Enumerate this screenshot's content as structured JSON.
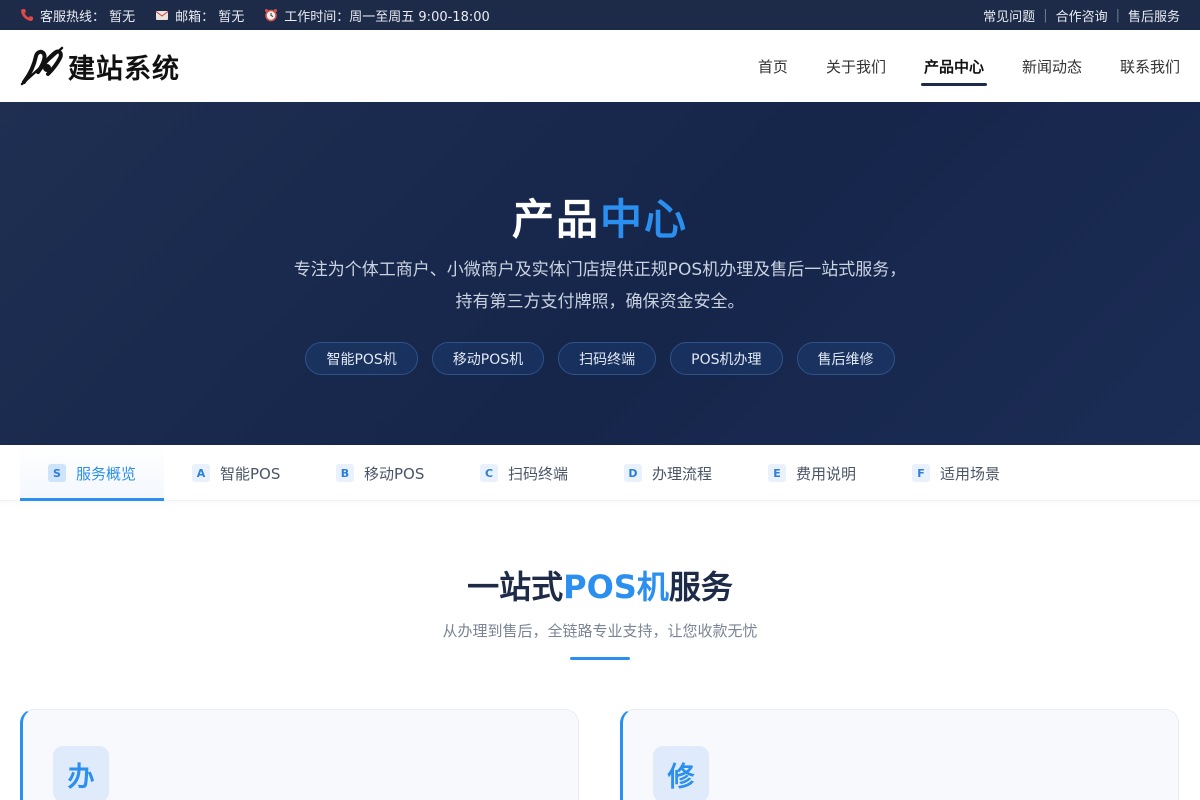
{
  "topbar": {
    "hotline": "客服热线：  暂无",
    "email": "邮箱：  暂无",
    "hours": "工作时间：周一至周五 9:00-18:00",
    "links": [
      "常见问题",
      "合作咨询",
      "售后服务"
    ]
  },
  "brand": {
    "name": "建站系统"
  },
  "nav": [
    "首页",
    "关于我们",
    "产品中心",
    "新闻动态",
    "联系我们"
  ],
  "hero": {
    "title_main": "产品",
    "title_highlight": "中心",
    "description": "专注为个体工商户、小微商户及实体门店提供正规POS机办理及售后一站式服务，持有第三方支付牌照，确保资金安全。",
    "tags": [
      "智能POS机",
      "移动POS机",
      "扫码终端",
      "POS机办理",
      "售后维修"
    ]
  },
  "tabs": [
    {
      "badge": "S",
      "label": "服务概览"
    },
    {
      "badge": "A",
      "label": "智能POS"
    },
    {
      "badge": "B",
      "label": "移动POS"
    },
    {
      "badge": "C",
      "label": "扫码终端"
    },
    {
      "badge": "D",
      "label": "办理流程"
    },
    {
      "badge": "E",
      "label": "费用说明"
    },
    {
      "badge": "F",
      "label": "适用场景"
    }
  ],
  "section": {
    "title_pre": "一站式",
    "title_highlight": "POS机",
    "title_post": "服务",
    "subtitle": "从办理到售后，全链路专业支持，让您收款无忧"
  },
  "cards": [
    {
      "icon_char": "办"
    },
    {
      "icon_char": "修"
    }
  ],
  "colors": {
    "navy": "#1d2b49",
    "accent": "#2b8ff0",
    "hero_bg": "#16254a"
  }
}
